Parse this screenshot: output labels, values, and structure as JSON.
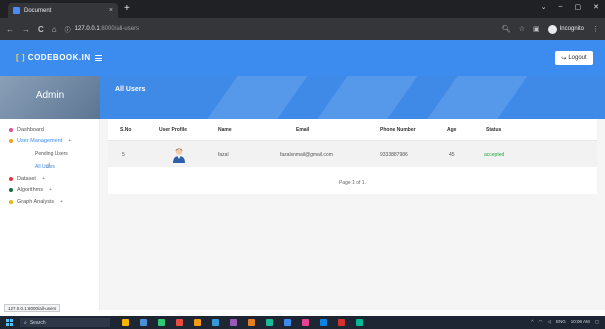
{
  "browser": {
    "tab_title": "Document",
    "tab_close": "×",
    "new_tab": "+",
    "window_controls": [
      "⌄",
      "–",
      "▢",
      "✕"
    ],
    "url_host": "127.0.0.1",
    "url_path": ":8000/all-users",
    "incognito_label": "Incognito",
    "nav_back": "←",
    "nav_forward": "→",
    "nav_reload": "C",
    "nav_home": "⌂"
  },
  "header": {
    "logo_bracket": "[ ]",
    "logo_text": "CODEBOOK.IN",
    "logout_label": "Logout"
  },
  "banner": {
    "admin_label": "Admin",
    "page_title": "All Users"
  },
  "sidebar": {
    "items": [
      {
        "label": "Dashboard",
        "color": "#e05297"
      },
      {
        "label": "User Management",
        "plus": "+",
        "color": "#f0a020"
      },
      {
        "label": "Dataset",
        "plus": "+",
        "color": "#e53935"
      },
      {
        "label": "Algorithms",
        "plus": "+",
        "color": "#1a6b3c"
      },
      {
        "label": "Graph Analysis",
        "plus": "+",
        "color": "#e6b800"
      }
    ],
    "sub_items": [
      {
        "label": "Pending Users"
      },
      {
        "label": "All Users"
      }
    ]
  },
  "table": {
    "headers": [
      "S.No",
      "User Profile",
      "Name",
      "Email",
      "Phone Number",
      "Age",
      "Status"
    ],
    "rows": [
      {
        "sno": "5",
        "name": "fazal",
        "email": "fazalsnmail@gmail.com",
        "phone": "9333887986",
        "age": "45",
        "status": "accepted"
      }
    ],
    "pagination": "Page 1 of 1."
  },
  "status_url": "127.0.0.1:8000/all-users",
  "taskbar": {
    "search_label": "Search",
    "time": "10:06 AM",
    "tray_lang": "ENG"
  },
  "colors": {
    "accent": "#3c8cf0",
    "status_accepted": "#28a745"
  }
}
